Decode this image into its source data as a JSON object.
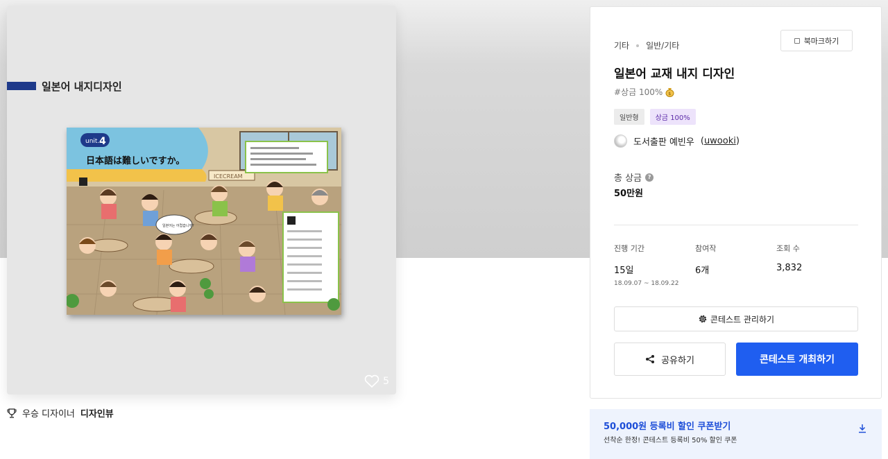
{
  "artwork": {
    "title": "일본어 내지디자인",
    "like_count": "5",
    "image": {
      "unit_label": "unit.",
      "unit_number": "4",
      "heading": "日本語は難しいですか。",
      "signboard": "ICECREAM",
      "speech_bubble": "일본어는 어렵습니까?"
    }
  },
  "winner": {
    "prefix": "우승 디자이너",
    "link": "디자인뷰"
  },
  "contest": {
    "category": "기타",
    "subcategory": "일반/기타",
    "bookmark_label": "북마크하기",
    "title": "일본어 교재 내지 디자인",
    "prize_tag": "#상금 100%",
    "badges": [
      "일반형",
      "상금 100%"
    ],
    "owner_name": "도서출판 예빈우",
    "owner_id": "uwooki",
    "total_prize_label": "총 상금",
    "total_prize_value": "50만원",
    "stats": {
      "period_label": "진행 기간",
      "period_value": "15일",
      "period_range": "18.09.07 ~ 18.09.22",
      "entries_label": "참여작",
      "entries_value": "6개",
      "views_label": "조회 수",
      "views_value": "3,832"
    },
    "manage_label": "콘테스트 관리하기",
    "share_label": "공유하기",
    "host_label": "콘테스트 개최하기"
  },
  "coupon": {
    "title": "50,000원 등록비 할인 쿠폰받기",
    "subtitle": "선착순 한정! 콘테스트 등록비 50% 할인 쿠폰"
  },
  "colors": {
    "accent_blue": "#1f5ef0",
    "title_bar_navy": "#1e3a8a",
    "coupon_text_blue": "#1d4ed8",
    "purple_badge_bg": "#ede3fb"
  }
}
